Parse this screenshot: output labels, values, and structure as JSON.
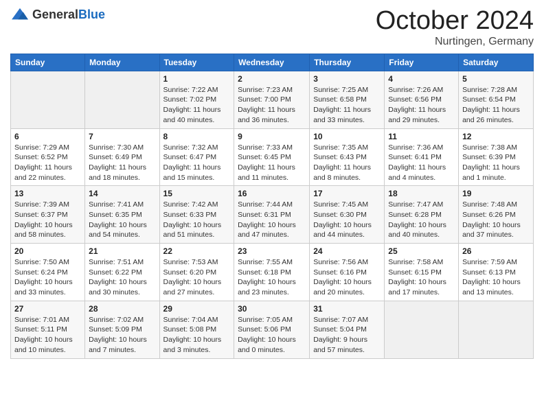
{
  "header": {
    "logo_general": "General",
    "logo_blue": "Blue",
    "month_title": "October 2024",
    "location": "Nurtingen, Germany"
  },
  "weekdays": [
    "Sunday",
    "Monday",
    "Tuesday",
    "Wednesday",
    "Thursday",
    "Friday",
    "Saturday"
  ],
  "weeks": [
    [
      {
        "day": "",
        "info": ""
      },
      {
        "day": "",
        "info": ""
      },
      {
        "day": "1",
        "info": "Sunrise: 7:22 AM\nSunset: 7:02 PM\nDaylight: 11 hours and 40 minutes."
      },
      {
        "day": "2",
        "info": "Sunrise: 7:23 AM\nSunset: 7:00 PM\nDaylight: 11 hours and 36 minutes."
      },
      {
        "day": "3",
        "info": "Sunrise: 7:25 AM\nSunset: 6:58 PM\nDaylight: 11 hours and 33 minutes."
      },
      {
        "day": "4",
        "info": "Sunrise: 7:26 AM\nSunset: 6:56 PM\nDaylight: 11 hours and 29 minutes."
      },
      {
        "day": "5",
        "info": "Sunrise: 7:28 AM\nSunset: 6:54 PM\nDaylight: 11 hours and 26 minutes."
      }
    ],
    [
      {
        "day": "6",
        "info": "Sunrise: 7:29 AM\nSunset: 6:52 PM\nDaylight: 11 hours and 22 minutes."
      },
      {
        "day": "7",
        "info": "Sunrise: 7:30 AM\nSunset: 6:49 PM\nDaylight: 11 hours and 18 minutes."
      },
      {
        "day": "8",
        "info": "Sunrise: 7:32 AM\nSunset: 6:47 PM\nDaylight: 11 hours and 15 minutes."
      },
      {
        "day": "9",
        "info": "Sunrise: 7:33 AM\nSunset: 6:45 PM\nDaylight: 11 hours and 11 minutes."
      },
      {
        "day": "10",
        "info": "Sunrise: 7:35 AM\nSunset: 6:43 PM\nDaylight: 11 hours and 8 minutes."
      },
      {
        "day": "11",
        "info": "Sunrise: 7:36 AM\nSunset: 6:41 PM\nDaylight: 11 hours and 4 minutes."
      },
      {
        "day": "12",
        "info": "Sunrise: 7:38 AM\nSunset: 6:39 PM\nDaylight: 11 hours and 1 minute."
      }
    ],
    [
      {
        "day": "13",
        "info": "Sunrise: 7:39 AM\nSunset: 6:37 PM\nDaylight: 10 hours and 58 minutes."
      },
      {
        "day": "14",
        "info": "Sunrise: 7:41 AM\nSunset: 6:35 PM\nDaylight: 10 hours and 54 minutes."
      },
      {
        "day": "15",
        "info": "Sunrise: 7:42 AM\nSunset: 6:33 PM\nDaylight: 10 hours and 51 minutes."
      },
      {
        "day": "16",
        "info": "Sunrise: 7:44 AM\nSunset: 6:31 PM\nDaylight: 10 hours and 47 minutes."
      },
      {
        "day": "17",
        "info": "Sunrise: 7:45 AM\nSunset: 6:30 PM\nDaylight: 10 hours and 44 minutes."
      },
      {
        "day": "18",
        "info": "Sunrise: 7:47 AM\nSunset: 6:28 PM\nDaylight: 10 hours and 40 minutes."
      },
      {
        "day": "19",
        "info": "Sunrise: 7:48 AM\nSunset: 6:26 PM\nDaylight: 10 hours and 37 minutes."
      }
    ],
    [
      {
        "day": "20",
        "info": "Sunrise: 7:50 AM\nSunset: 6:24 PM\nDaylight: 10 hours and 33 minutes."
      },
      {
        "day": "21",
        "info": "Sunrise: 7:51 AM\nSunset: 6:22 PM\nDaylight: 10 hours and 30 minutes."
      },
      {
        "day": "22",
        "info": "Sunrise: 7:53 AM\nSunset: 6:20 PM\nDaylight: 10 hours and 27 minutes."
      },
      {
        "day": "23",
        "info": "Sunrise: 7:55 AM\nSunset: 6:18 PM\nDaylight: 10 hours and 23 minutes."
      },
      {
        "day": "24",
        "info": "Sunrise: 7:56 AM\nSunset: 6:16 PM\nDaylight: 10 hours and 20 minutes."
      },
      {
        "day": "25",
        "info": "Sunrise: 7:58 AM\nSunset: 6:15 PM\nDaylight: 10 hours and 17 minutes."
      },
      {
        "day": "26",
        "info": "Sunrise: 7:59 AM\nSunset: 6:13 PM\nDaylight: 10 hours and 13 minutes."
      }
    ],
    [
      {
        "day": "27",
        "info": "Sunrise: 7:01 AM\nSunset: 5:11 PM\nDaylight: 10 hours and 10 minutes."
      },
      {
        "day": "28",
        "info": "Sunrise: 7:02 AM\nSunset: 5:09 PM\nDaylight: 10 hours and 7 minutes."
      },
      {
        "day": "29",
        "info": "Sunrise: 7:04 AM\nSunset: 5:08 PM\nDaylight: 10 hours and 3 minutes."
      },
      {
        "day": "30",
        "info": "Sunrise: 7:05 AM\nSunset: 5:06 PM\nDaylight: 10 hours and 0 minutes."
      },
      {
        "day": "31",
        "info": "Sunrise: 7:07 AM\nSunset: 5:04 PM\nDaylight: 9 hours and 57 minutes."
      },
      {
        "day": "",
        "info": ""
      },
      {
        "day": "",
        "info": ""
      }
    ]
  ]
}
